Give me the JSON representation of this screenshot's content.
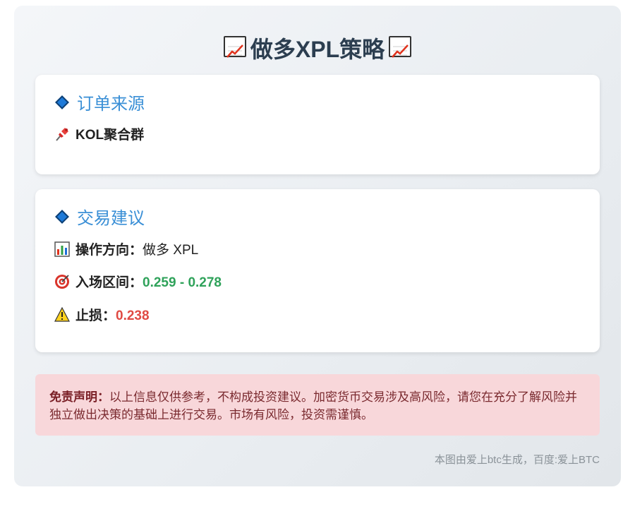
{
  "title": "做多XPL策略",
  "source_card": {
    "heading": "订单来源",
    "source_name": "KOL聚合群"
  },
  "trade_card": {
    "heading": "交易建议",
    "direction_label": "操作方向：",
    "direction_value": "做多 XPL",
    "entry_label": "入场区间：",
    "entry_value": "0.259 - 0.278",
    "stop_label": "止损：",
    "stop_value": "0.238"
  },
  "disclaimer": {
    "label": "免责声明：",
    "text": "以上信息仅供参考，不构成投资建议。加密货币交易涉及高风险，请您在充分了解风险并独立做出决策的基础上进行交易。市场有风险，投资需谨慎。"
  },
  "footer": "本图由爱上btc生成，百度:爱上BTC",
  "colors": {
    "accent": "#3a8fd6",
    "entry": "#2fa25a",
    "stop": "#e04a43",
    "disclaimer_bg": "#f8d7da"
  },
  "icons": {
    "title": "chart-increasing-icon",
    "heading": "blue-diamond-icon",
    "source": "pushpin-icon",
    "direction": "bar-chart-icon",
    "entry": "target-icon",
    "stop": "warning-icon"
  }
}
